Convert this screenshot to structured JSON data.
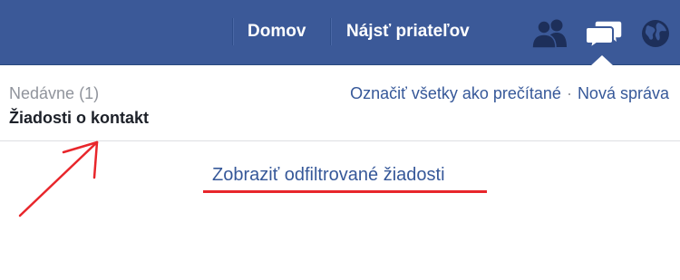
{
  "header": {
    "nav": {
      "home_label": "Domov",
      "find_friends_label": "Nájsť priateľov"
    },
    "icons": [
      "friend-requests-icon",
      "messages-icon",
      "notifications-globe-icon"
    ],
    "background_color": "#3b5998"
  },
  "messages_panel": {
    "recent_label": "Nedávne",
    "recent_count": "(1)",
    "requests_label": "Žiadosti o kontakt",
    "mark_all_read_label": "Označiť všetky ako prečítané",
    "separator": "·",
    "new_message_label": "Nová správa",
    "show_filtered_label": "Zobraziť odfiltrované žiadosti"
  },
  "annotations": {
    "color": "#e8262b",
    "arrow_points_to": "requests_label",
    "underline_marks": "show_filtered_label"
  }
}
